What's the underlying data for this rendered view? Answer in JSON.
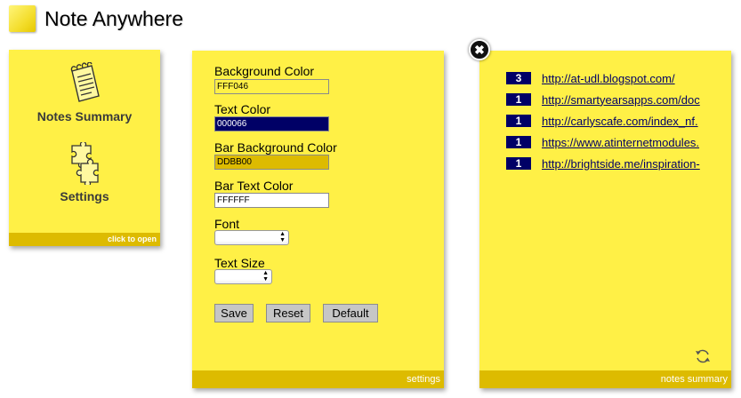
{
  "app": {
    "title": "Note Anywhere"
  },
  "launcher": {
    "items": [
      {
        "label": "Notes Summary",
        "icon": "notepad-icon"
      },
      {
        "label": "Settings",
        "icon": "puzzle-icon"
      }
    ],
    "bar_text": "click to open"
  },
  "settings": {
    "background_color": {
      "label": "Background Color",
      "value": "FFF046"
    },
    "text_color": {
      "label": "Text Color",
      "value": "000066"
    },
    "bar_background_color": {
      "label": "Bar Background Color",
      "value": "DDBB00"
    },
    "bar_text_color": {
      "label": "Bar Text Color",
      "value": "FFFFFF"
    },
    "font": {
      "label": "Font",
      "value": ""
    },
    "text_size": {
      "label": "Text Size",
      "value": ""
    },
    "buttons": {
      "save": "Save",
      "reset": "Reset",
      "default": "Default"
    },
    "bar_text": "settings"
  },
  "summary": {
    "close_glyph": "✖",
    "items": [
      {
        "count": "3",
        "url": "http://at-udl.blogspot.com/"
      },
      {
        "count": "1",
        "url": "http://smartyearsapps.com/doc"
      },
      {
        "count": "1",
        "url": "http://carlyscafe.com/index_nf."
      },
      {
        "count": "1",
        "url": "https://www.atinternetmodules."
      },
      {
        "count": "1",
        "url": "http://brightside.me/inspiration-"
      }
    ],
    "bar_text": "notes summary"
  },
  "colors": {
    "note_bg": "#fff046",
    "bar_bg": "#ddbb00",
    "bar_text": "#ffffff",
    "accent": "#000066"
  }
}
